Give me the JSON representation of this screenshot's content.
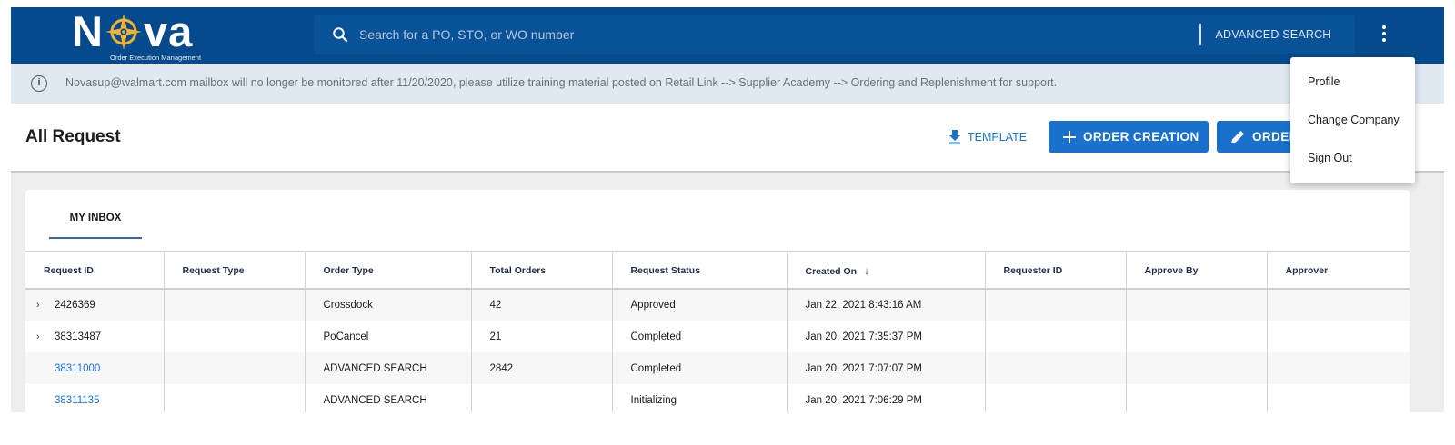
{
  "app": {
    "logo_text_left": "N",
    "logo_text_right": "va",
    "logo_subtitle": "Order Execution Management"
  },
  "search": {
    "placeholder": "Search for a PO, STO, or WO number",
    "advanced_label": "ADVANCED SEARCH"
  },
  "banner": {
    "text": "Novasup@walmart.com mailbox will no longer be monitored after 11/20/2020, please utilize training material posted on Retail Link --> Supplier Academy --> Ordering and Replenishment for support."
  },
  "header": {
    "title": "All Request",
    "template_label": "TEMPLATE",
    "order_creation_label": "ORDER CREATION",
    "order_edit_label": "ORDER"
  },
  "tabs": [
    {
      "label": "MY INBOX",
      "active": true
    }
  ],
  "table": {
    "columns": [
      "Request ID",
      "Request Type",
      "Order Type",
      "Total Orders",
      "Request Status",
      "Created On",
      "Requester ID",
      "Approve By",
      "Approver"
    ],
    "sort_column": "Created On",
    "rows": [
      {
        "request_id": "2426369",
        "expandable": true,
        "link": false,
        "request_type": "",
        "order_type": "Crossdock",
        "total_orders": "42",
        "status": "Approved",
        "created_on": "Jan 22, 2021 8:43:16 AM",
        "requester_id": "",
        "approve_by": "",
        "approver": ""
      },
      {
        "request_id": "38313487",
        "expandable": true,
        "link": false,
        "request_type": "",
        "order_type": "PoCancel",
        "total_orders": "21",
        "status": "Completed",
        "created_on": "Jan 20, 2021 7:35:37 PM",
        "requester_id": "",
        "approve_by": "",
        "approver": ""
      },
      {
        "request_id": "38311000",
        "expandable": false,
        "link": true,
        "request_type": "",
        "order_type": "ADVANCED SEARCH",
        "total_orders": "2842",
        "status": "Completed",
        "created_on": "Jan 20, 2021 7:07:07 PM",
        "requester_id": "",
        "approve_by": "",
        "approver": ""
      },
      {
        "request_id": "38311135",
        "expandable": false,
        "link": true,
        "request_type": "",
        "order_type": "ADVANCED SEARCH",
        "total_orders": "",
        "status": "Initializing",
        "created_on": "Jan 20, 2021 7:06:29 PM",
        "requester_id": "",
        "approve_by": "",
        "approver": ""
      }
    ]
  },
  "menu": {
    "items": [
      "Profile",
      "Change Company",
      "Sign Out"
    ]
  },
  "colors": {
    "brand_blue": "#044a8d",
    "button_blue": "#1a71cc",
    "link_blue": "#1a6fd4",
    "logo_gold": "#f2b233",
    "banner_bg": "#dfe9f1"
  }
}
